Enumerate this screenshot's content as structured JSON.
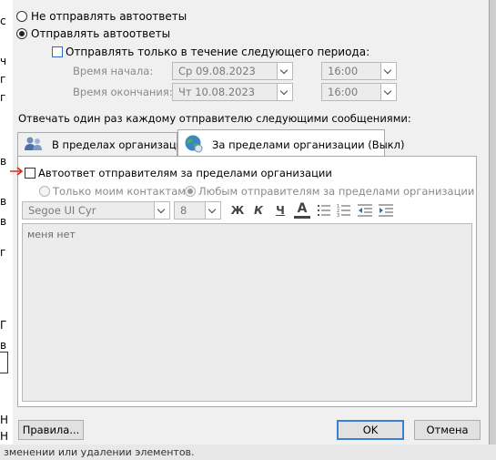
{
  "background_app": {
    "glyphs": [
      "с",
      "ч",
      "г",
      "г",
      "в",
      "в",
      "в",
      "г",
      "Г",
      "в",
      "Н",
      "Н"
    ],
    "bottom_text": "зменении или удалении элементов."
  },
  "auto_reply": {
    "option_off": "Не отправлять автоответы",
    "option_on": "Отправлять автоответы",
    "period_label": "Отправлять только в течение следующего периода:",
    "start_label": "Время начала:",
    "start_date": "Ср 09.08.2023",
    "start_time": "16:00",
    "end_label": "Время окончания:",
    "end_date": "Чт 10.08.2023",
    "end_time": "16:00",
    "reply_once_label": "Отвечать один раз каждому отправителю следующими сообщениями:"
  },
  "tabs": [
    {
      "label": "В пределах организации"
    },
    {
      "label": "За пределами организации (Выкл)"
    }
  ],
  "outside": {
    "auto_reply_checkbox": "Автоответ отправителям за пределами организации",
    "only_contacts": "Только моим контактам",
    "all_senders": "Любым отправителям за пределами организации"
  },
  "toolbar": {
    "font": "Segoe UI Cyr",
    "size": "8",
    "bold": "Ж",
    "italic": "К",
    "underline": "Ч",
    "font_color": "А"
  },
  "editor": {
    "text": "меня нет"
  },
  "footer": {
    "rules_button": "Правила...",
    "ok_button": "OK",
    "cancel_button": "Отмена"
  },
  "colors": {
    "annotation_arrow": "#e0261b",
    "default_button_border": "#3c7fd6"
  }
}
